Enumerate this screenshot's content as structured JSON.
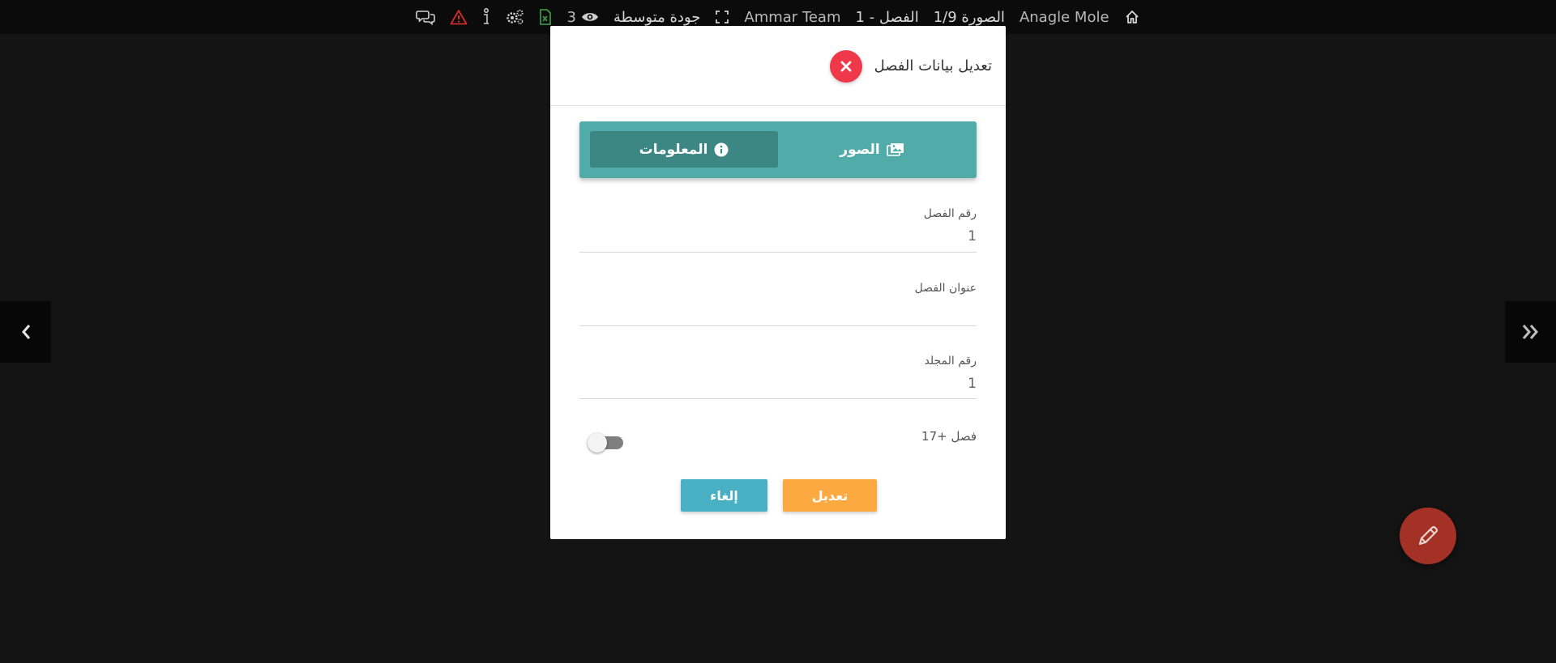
{
  "topbar": {
    "home_label": "",
    "manga_title": "Anagle Mole",
    "image_label": "الصورة 1/9",
    "chapter_label": "الفصل - 1",
    "team_name": "Ammar Team",
    "quality_label": "جودة متوسطة",
    "views_count": "3",
    "colors": {
      "excel_icon": "#3fa34d",
      "warning_icon": "#d62b2b"
    }
  },
  "modal": {
    "title": "تعديل بيانات الفصل",
    "tabs": [
      {
        "label": "الصور",
        "icon": "images-icon",
        "active": false
      },
      {
        "label": "المعلومات",
        "icon": "info-icon",
        "active": true
      }
    ],
    "fields": [
      {
        "label": "رقم الفصل",
        "value": "1"
      },
      {
        "label": "عنوان الفصل",
        "value": ""
      },
      {
        "label": "رقم المجلد",
        "value": "1"
      }
    ],
    "toggle": {
      "label": "فصل +17",
      "on": false
    },
    "buttons": {
      "edit_label": "تعديل",
      "cancel_label": "إلغاء"
    },
    "colors": {
      "close": "#f0384b",
      "tabs_bg": "#51aca9",
      "tab_active": "#3c8683",
      "edit": "#fda942",
      "cancel": "#49b0c4"
    }
  },
  "fab": {
    "icon": "pencil-icon",
    "color": "#a33125"
  }
}
